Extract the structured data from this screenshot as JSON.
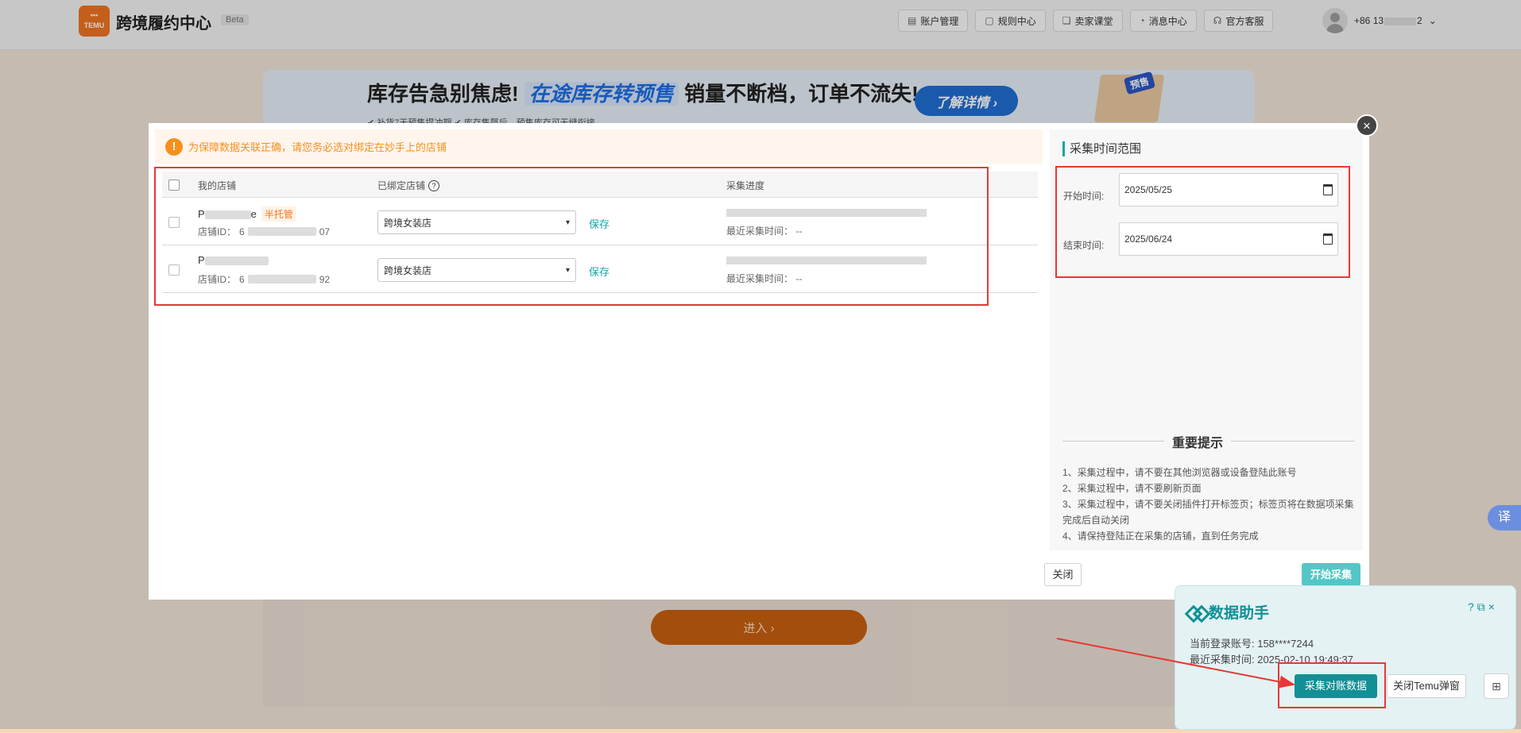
{
  "header": {
    "logo_text": "TEMU",
    "brand": "跨境履约中心",
    "beta": "Beta",
    "nav": [
      {
        "label": "账户管理",
        "icon": "id-card-icon",
        "glyph": "▤"
      },
      {
        "label": "规则中心",
        "icon": "document-icon",
        "glyph": "▢"
      },
      {
        "label": "卖家课堂",
        "icon": "book-icon",
        "glyph": "❏"
      },
      {
        "label": "消息中心",
        "icon": "bell-icon",
        "glyph": "◔"
      },
      {
        "label": "官方客服",
        "icon": "headset-icon",
        "glyph": "☊"
      }
    ],
    "user_prefix": "+86 13",
    "user_suffix": "2"
  },
  "banner": {
    "text_before": "库存告急别焦虑!",
    "highlight": "在途库存转预售",
    "text_after": "销量不断档，订单不流失!",
    "button": "了解详情 ›",
    "tag": "预售",
    "sub": "✔ 补货7天预售提冲期  ✔ 库存售罄后，预售库存可无缝衔接"
  },
  "enter_button": "进入 ›",
  "modal": {
    "notice": "为保障数据关联正确，请您务必选对绑定在妙手上的店铺",
    "columns": {
      "shop": "我的店铺",
      "bound": "已绑定店铺",
      "progress": "采集进度"
    },
    "rows": [
      {
        "name_start": "P",
        "name_end": "e",
        "tag": "半托管",
        "id_label": "店铺ID：",
        "id_start": "6",
        "id_end": "07",
        "bound_shop": "跨境女装店",
        "save": "保存",
        "last_time": "最近采集时间： --"
      },
      {
        "name_start": "P",
        "name_end": "",
        "tag": "",
        "id_label": "店铺ID：",
        "id_start": "6",
        "id_end": "92",
        "bound_shop": "跨境女装店",
        "save": "保存",
        "last_time": "最近采集时间： --"
      }
    ],
    "time_range_title": "采集时间范围",
    "start_label": "开始时间:",
    "start_value": "2025/05/25",
    "end_label": "结束时间:",
    "end_value": "2025/06/24",
    "tips_title": "重要提示",
    "tips": [
      "1、采集过程中，请不要在其他浏览器或设备登陆此账号",
      "2、采集过程中，请不要刷新页面",
      "3、采集过程中，请不要关闭插件打开标签页；标签页将在数据项采集完成后自动关闭",
      "4、请保持登陆正在采集的店铺，直到任务完成"
    ],
    "close_btn": "关闭",
    "start_btn": "开始采集",
    "close_icon": "×"
  },
  "helper": {
    "title": "数据助手",
    "account_line": "当前登录账号: 158****7244",
    "collect_time_line": "最近采集时间: 2025-02-10 19:49:37",
    "collect_btn": "采集对账数据",
    "close_temu_btn": "关闭Temu弹窗",
    "grid_glyph": "⊞",
    "tool_glyphs": [
      "?",
      "⧉",
      "×"
    ]
  },
  "translate": "译"
}
